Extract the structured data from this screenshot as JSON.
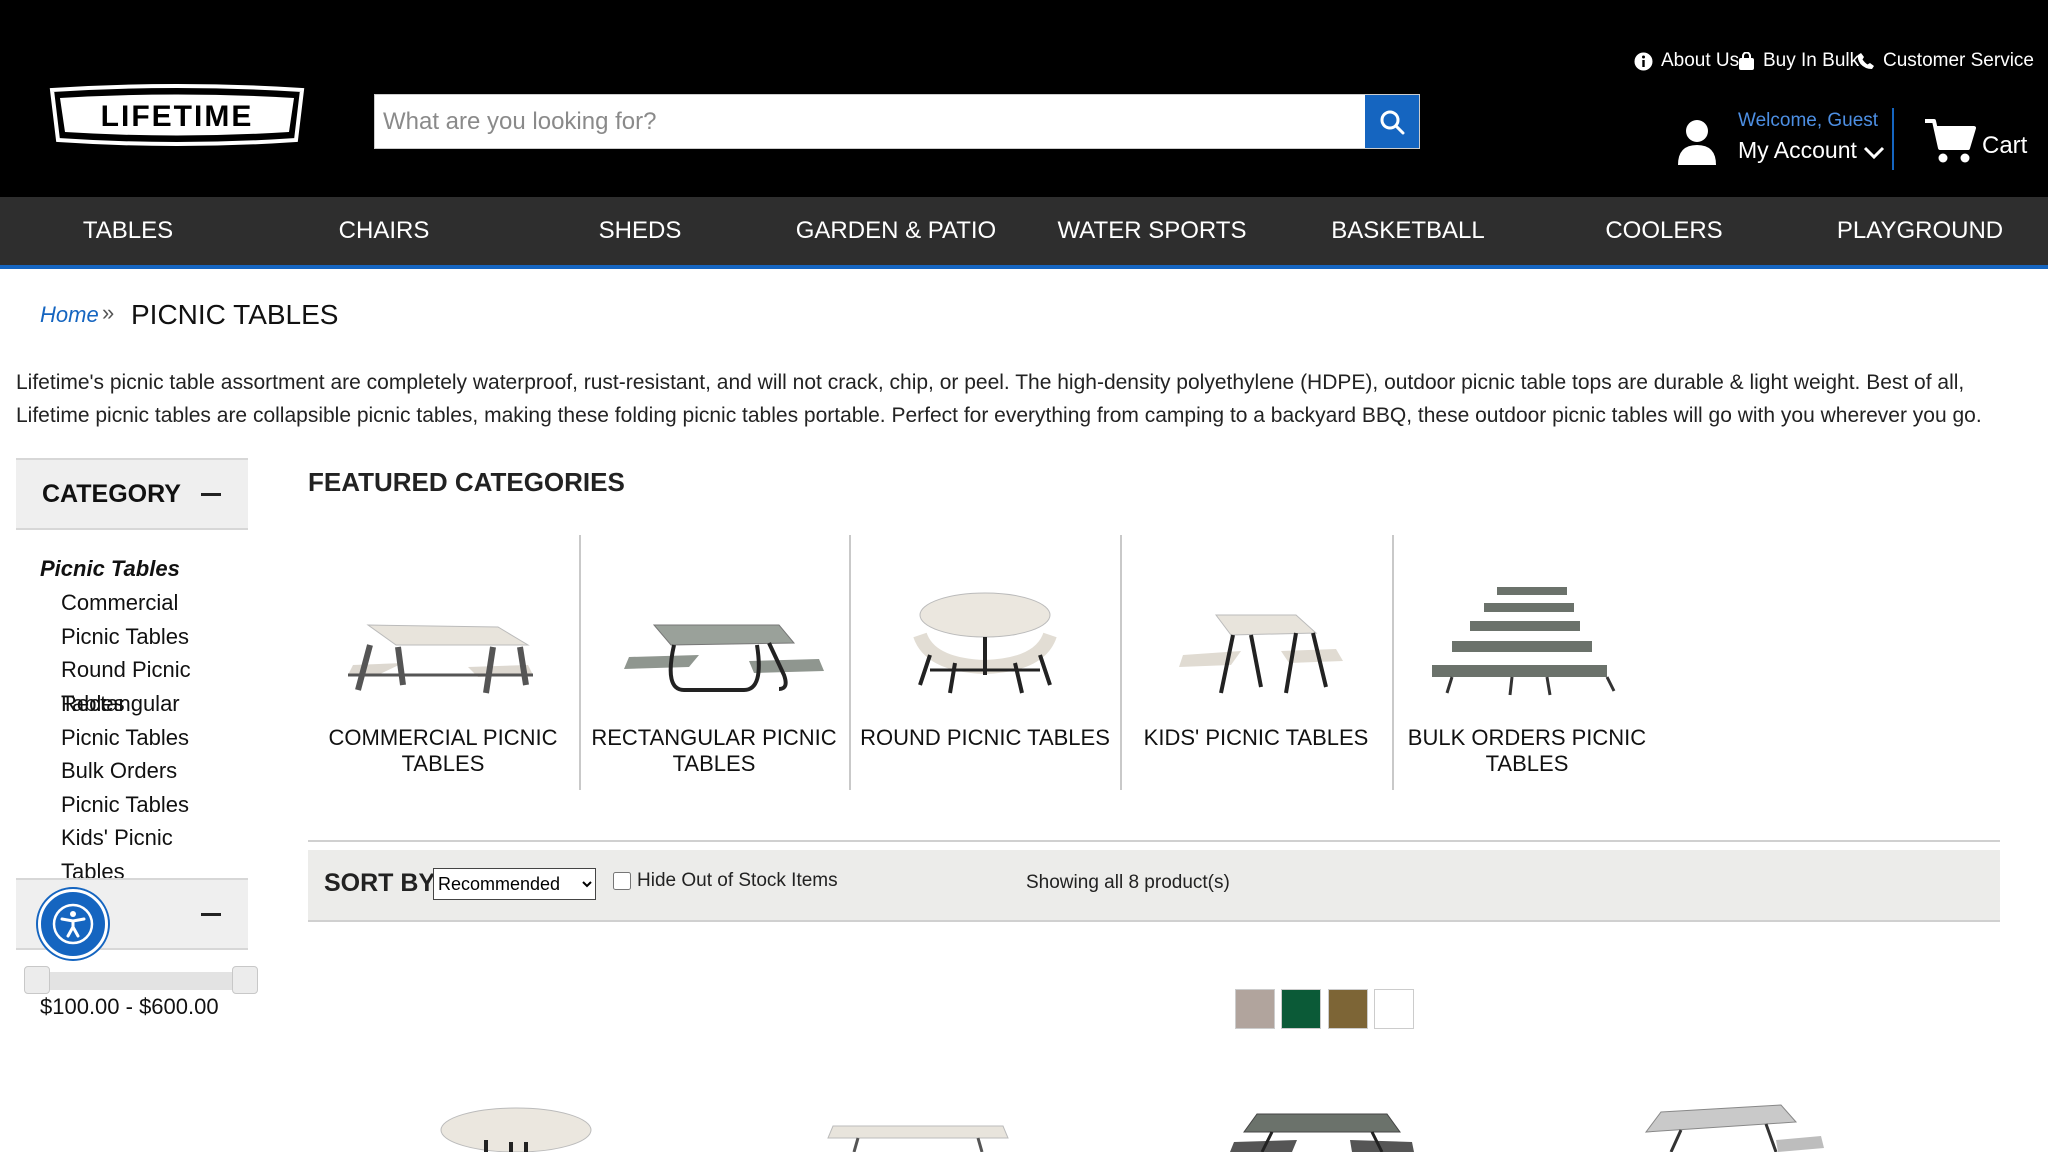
{
  "header": {
    "logo_text": "LIFETIME",
    "search_placeholder": "What are you looking for?",
    "utility_links": [
      "About Us",
      "Buy In Bulk",
      "Customer Service"
    ],
    "welcome": "Welcome, Guest",
    "my_account": "My Account",
    "cart": "Cart"
  },
  "nav": [
    "TABLES",
    "CHAIRS",
    "SHEDS",
    "GARDEN & PATIO",
    "WATER SPORTS",
    "BASKETBALL",
    "COOLERS",
    "PLAYGROUND"
  ],
  "breadcrumb": {
    "home": "Home",
    "separator": "»",
    "current": "PICNIC TABLES"
  },
  "description": "Lifetime's picnic table assortment are completely waterproof, rust-resistant, and will not crack, chip, or peel. The high-density polyethylene (HDPE), outdoor picnic table tops are durable & light weight. Best of all, Lifetime picnic tables are collapsible picnic tables, making these folding picnic tables portable. Perfect for everything from camping to a backyard BBQ, these outdoor picnic tables will go with you wherever you go.",
  "sidebar": {
    "category_title": "CATEGORY",
    "category_parent": "Picnic Tables",
    "category_links": [
      "Commercial Picnic Tables",
      "Round Picnic Tables",
      "Rectangular Picnic Tables",
      "Bulk Orders Picnic Tables",
      "Kids' Picnic Tables"
    ],
    "price_range": "$100.00 - $600.00"
  },
  "featured": {
    "title": "FEATURED CATEGORIES",
    "items": [
      "COMMERCIAL PICNIC TABLES",
      "RECTANGULAR PICNIC TABLES",
      "ROUND PICNIC TABLES",
      "KIDS' PICNIC TABLES",
      "BULK ORDERS PICNIC TABLES"
    ]
  },
  "sort": {
    "label": "SORT BY:",
    "selected": "Recommended",
    "hide_out_of_stock": "Hide Out of Stock Items",
    "showing": "Showing all 8 product(s)"
  },
  "swatches": [
    "#b1a49d",
    "#0b5a37",
    "#7d6536",
    "#ffffff"
  ],
  "colors": {
    "accent": "#1565c0",
    "header_bg": "#000000",
    "nav_bg": "#2e2e2e"
  }
}
